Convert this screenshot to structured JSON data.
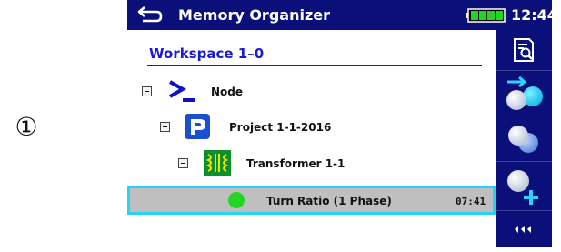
{
  "step_marker": "①",
  "header": {
    "title": "Memory Organizer",
    "time": "12:44",
    "battery_color": "#1ed81e"
  },
  "workspace": {
    "label": "Workspace 1–0"
  },
  "tree": {
    "node": {
      "label": "Node"
    },
    "project": {
      "label": "Project 1-1-2016"
    },
    "transformer": {
      "label": "Transformer 1-1"
    },
    "measurement": {
      "label": "Turn Ratio (1 Phase)",
      "time": "07:41",
      "status_color": "#24d524"
    }
  },
  "sidebar": {
    "buttons": [
      {
        "icon": "view-results-icon"
      },
      {
        "icon": "start-measurement-icon"
      },
      {
        "icon": "clone-icon"
      },
      {
        "icon": "add-new-icon"
      },
      {
        "icon": "collapse-arrows-icon"
      }
    ]
  },
  "colors": {
    "header_bg": "#0b0f7a",
    "selection_border": "#26d4f0",
    "workspace_text": "#1a1ad6"
  }
}
